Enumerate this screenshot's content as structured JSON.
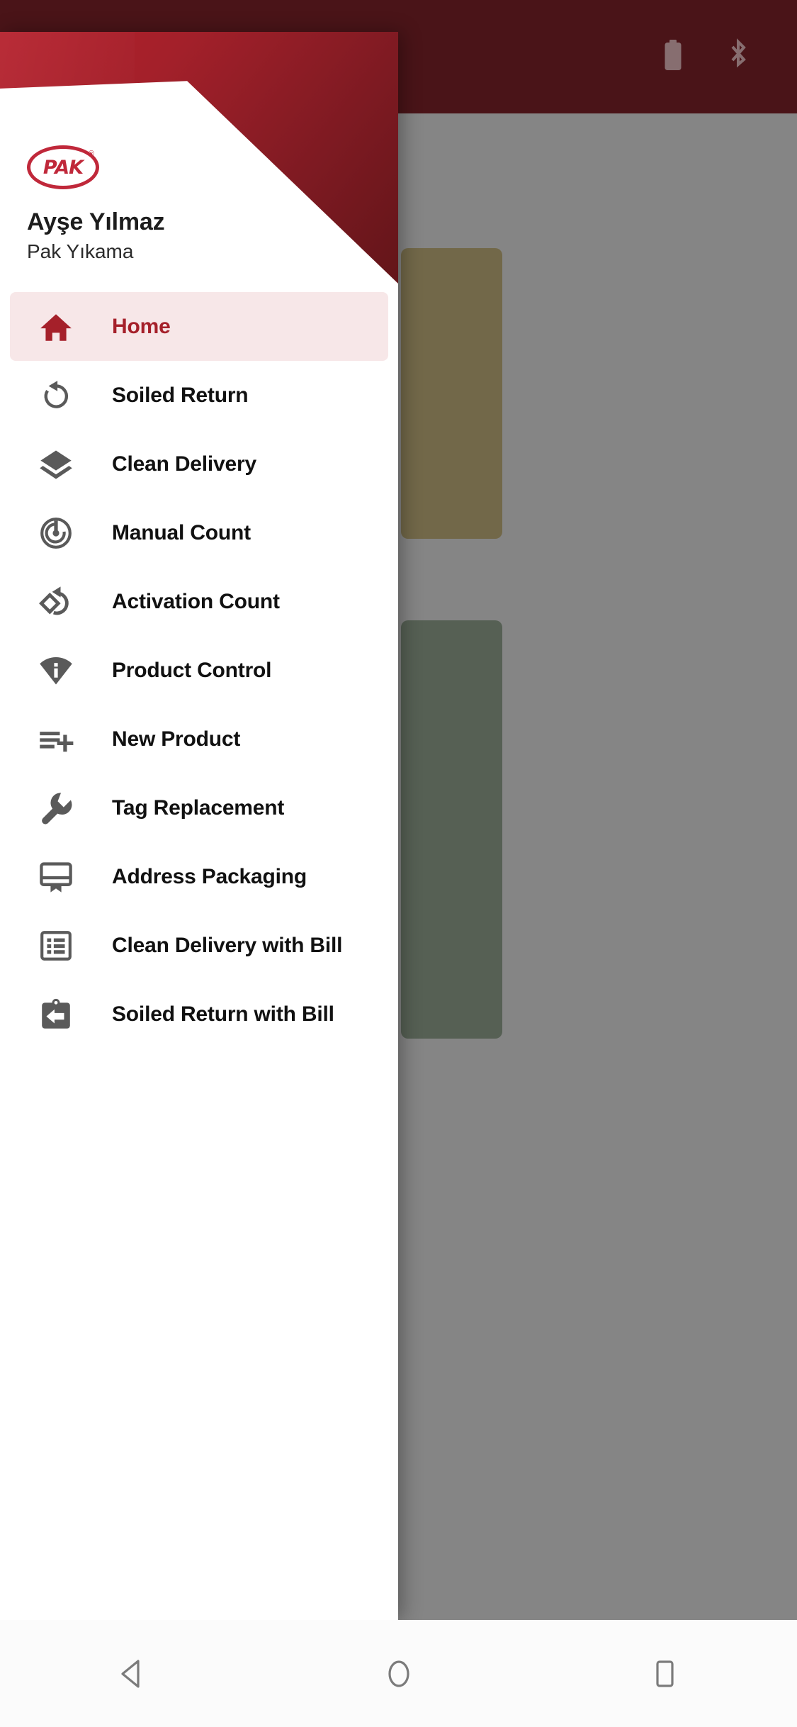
{
  "statusbar": {
    "icons": [
      {
        "name": "battery-icon",
        "label": "Battery"
      },
      {
        "name": "bluetooth-icon",
        "label": "Bluetooth"
      }
    ]
  },
  "drawer": {
    "brand": {
      "logo_text": "PAK",
      "logo_trademark": "®",
      "logo_name": "pak-logo"
    },
    "user": {
      "name": "Ayşe Yılmaz",
      "organization": "Pak Yıkama"
    },
    "menu": [
      {
        "label": "Home",
        "icon": "home-icon",
        "active": true
      },
      {
        "label": "Soiled Return",
        "icon": "rotate-left-icon",
        "active": false
      },
      {
        "label": "Clean Delivery",
        "icon": "layers-icon",
        "active": false
      },
      {
        "label": "Manual Count",
        "icon": "target-radar-icon",
        "active": false
      },
      {
        "label": "Activation Count",
        "icon": "diamond-rotate-icon",
        "active": false
      },
      {
        "label": "Product Control",
        "icon": "info-signal-icon",
        "active": false
      },
      {
        "label": "New Product",
        "icon": "list-plus-icon",
        "active": false
      },
      {
        "label": "Tag Replacement",
        "icon": "wrench-icon",
        "active": false
      },
      {
        "label": "Address Packaging",
        "icon": "label-tag-icon",
        "active": false
      },
      {
        "label": "Clean Delivery with Bill",
        "icon": "receipt-list-icon",
        "active": false
      },
      {
        "label": "Soiled Return with Bill",
        "icon": "clipboard-arrow-left-icon",
        "active": false
      }
    ]
  },
  "navbar": {
    "buttons": [
      {
        "name": "nav-back-button",
        "label": "Back"
      },
      {
        "name": "nav-home-button",
        "label": "Home"
      },
      {
        "name": "nav-recents-button",
        "label": "Recents"
      }
    ]
  },
  "colors": {
    "brand_red": "#a5202a",
    "banner_dark": "#631519",
    "status_bar": "#4a1418",
    "active_row_bg": "#f7e7e8",
    "icon_gray": "#5a5a5a",
    "scrim_gray": "#858585"
  }
}
